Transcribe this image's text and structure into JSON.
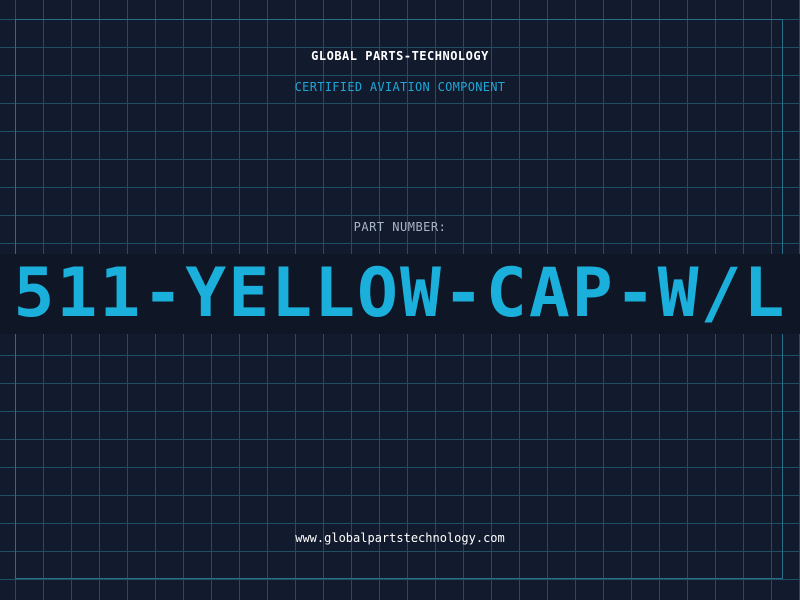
{
  "label": {
    "company": "GLOBAL PARTS-TECHNOLOGY",
    "subtitle": "CERTIFIED AVIATION COMPONENT",
    "part_number_label": "PART NUMBER:",
    "part_number": "511-YELLOW-CAP-W/L",
    "website": "www.globalpartstechnology.com"
  },
  "colors": {
    "background": "#121a2d",
    "grid": "#1f4f63",
    "accent": "#1ab0db",
    "text": "#ffffff",
    "muted": "#a9b5c8"
  }
}
